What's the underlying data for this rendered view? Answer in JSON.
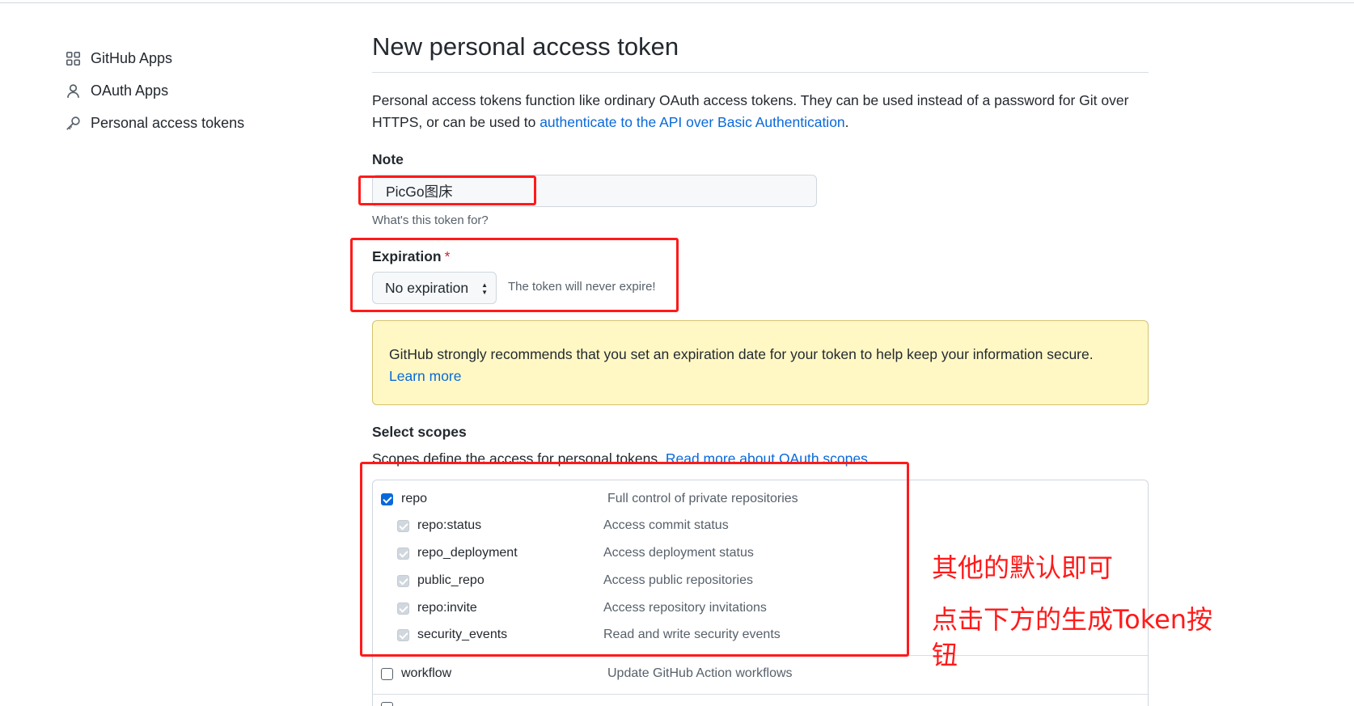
{
  "sidebar": {
    "items": [
      {
        "label": "GitHub Apps",
        "icon": "apps-grid-icon"
      },
      {
        "label": "OAuth Apps",
        "icon": "person-icon"
      },
      {
        "label": "Personal access tokens",
        "icon": "key-icon"
      }
    ]
  },
  "main": {
    "title": "New personal access token",
    "intro_text": "Personal access tokens function like ordinary OAuth access tokens. They can be used instead of a password for Git over HTTPS, or can be used to ",
    "intro_link": "authenticate to the API over Basic Authentication",
    "intro_end": "."
  },
  "note": {
    "label": "Note",
    "value": "PicGo图床",
    "hint": "What's this token for?"
  },
  "expiration": {
    "label": "Expiration",
    "required_mark": "*",
    "selected": "No expiration",
    "note": "The token will never expire!"
  },
  "warning": {
    "text": "GitHub strongly recommends that you set an expiration date for your token to help keep your information secure.",
    "link": "Learn more"
  },
  "scopes": {
    "label": "Select scopes",
    "desc": "Scopes define the access for personal tokens. ",
    "desc_link": "Read more about OAuth scopes",
    "rows": [
      {
        "name": "repo",
        "desc": "Full control of private repositories",
        "state": "checked"
      },
      {
        "name": "repo:status",
        "desc": "Access commit status",
        "state": "disabled"
      },
      {
        "name": "repo_deployment",
        "desc": "Access deployment status",
        "state": "disabled"
      },
      {
        "name": "public_repo",
        "desc": "Access public repositories",
        "state": "disabled"
      },
      {
        "name": "repo:invite",
        "desc": "Access repository invitations",
        "state": "disabled"
      },
      {
        "name": "security_events",
        "desc": "Read and write security events",
        "state": "disabled"
      },
      {
        "name": "workflow",
        "desc": "Update GitHub Action workflows",
        "state": "unchecked"
      }
    ]
  },
  "annotations": {
    "line1": "其他的默认即可",
    "line2": "点击下方的生成Token按钮",
    "color": "#ff1a1a"
  }
}
